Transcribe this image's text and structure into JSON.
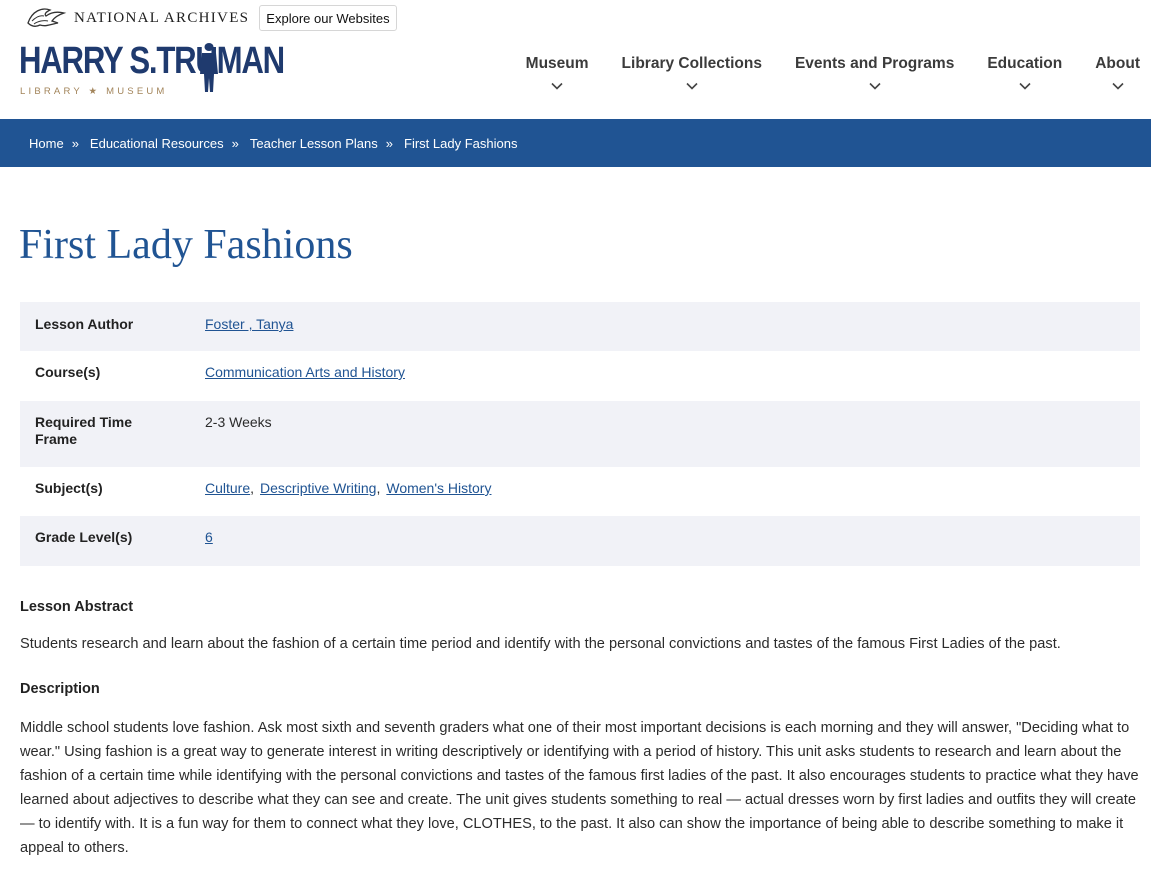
{
  "header": {
    "org_name": "NATIONAL ARCHIVES",
    "explore_label": "Explore our Websites",
    "logo_title": "HARRY S.TRUMAN",
    "logo_subtitle": "LIBRARY ★ MUSEUM"
  },
  "nav": {
    "items": [
      {
        "label": "Museum"
      },
      {
        "label": "Library Collections"
      },
      {
        "label": "Events and Programs"
      },
      {
        "label": "Education"
      },
      {
        "label": "About"
      }
    ]
  },
  "breadcrumb": {
    "items": [
      {
        "label": "Home"
      },
      {
        "label": "Educational Resources"
      },
      {
        "label": "Teacher Lesson Plans"
      },
      {
        "label": "First Lady Fashions"
      }
    ],
    "separator": "»"
  },
  "page": {
    "title": "First Lady Fashions"
  },
  "info": {
    "author": {
      "key": "Lesson Author",
      "value": "Foster , Tanya"
    },
    "courses": {
      "key": "Course(s)",
      "value": "Communication Arts and History"
    },
    "time": {
      "key": "Required Time Frame",
      "value": "2-3 Weeks"
    },
    "subjects": {
      "key": "Subject(s)",
      "values": [
        "Culture",
        "Descriptive Writing",
        "Women's History"
      ],
      "comma": ","
    },
    "grades": {
      "key": "Grade Level(s)",
      "value": "6"
    }
  },
  "abstract": {
    "heading": "Lesson Abstract",
    "text": "Students research and learn about the fashion of a certain time period and identify with the personal convictions and tastes of the famous First Ladies of the past."
  },
  "description": {
    "heading": "Description",
    "text": "Middle school students love fashion. Ask most sixth and seventh graders what one of their most important decisions is each morning and they will answer, \"Deciding what to wear.\" Using fashion is a great way to generate interest in writing descriptively or identifying with a period of history. This unit asks students to research and learn about the fashion of a certain time while identifying with the personal convictions and tastes of the famous first ladies of the past. It also encourages students to practice what they have learned about adjectives to describe what they can see and create. The unit gives students something to real — actual dresses worn by first ladies and outfits they will create — to identify with. It is a fun way for them to connect what they love, CLOTHES, to the past. It also can show the importance of being able to describe something to make it appeal to others."
  },
  "colors": {
    "brand_navy": "#1f3a6e",
    "breadcrumb_bg": "#205493",
    "link": "#205493",
    "logo_gold": "#a2845a",
    "row_shade": "#f1f2f7"
  },
  "icons": [
    "eagle-icon",
    "chevron-down-icon",
    "truman-silhouette-icon"
  ]
}
